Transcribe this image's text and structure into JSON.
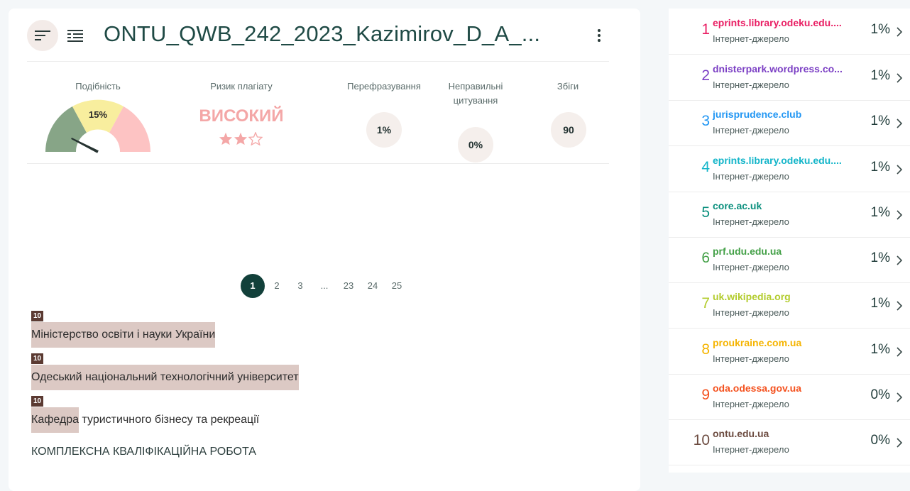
{
  "header": {
    "title": "ONTU_QWB_242_2023_Kazimirov_D_A_...",
    "icons": [
      "sort-icon",
      "list-view-icon",
      "kebab-menu-icon"
    ]
  },
  "metrics": {
    "similarity": {
      "label": "Подібність",
      "value": "15%",
      "fraction": 0.15
    },
    "risk": {
      "label": "Ризик плагіату",
      "value": "ВИСОКИЙ",
      "stars_filled": 2,
      "stars_total": 3
    },
    "paraphrase": {
      "label": "Перефразування",
      "value": "1%"
    },
    "citations": {
      "label": "Неправильні цитування",
      "value": "0%"
    },
    "matches": {
      "label": "Збіги",
      "value": "90"
    }
  },
  "pagination": {
    "pages": [
      "1",
      "2",
      "3",
      "...",
      "23",
      "24",
      "25"
    ],
    "current": "1"
  },
  "document": {
    "lines": [
      {
        "badge": "10",
        "highlight": "Міністерство освіти і науки України",
        "rest": ""
      },
      {
        "badge": "10",
        "highlight": "Одеський національний технологічний університет",
        "rest": ""
      },
      {
        "badge": "10",
        "highlight": "Кафедра",
        "rest": " туристичного бізнесу та рекреації"
      }
    ],
    "section_title": "КОМПЛЕКСНА КВАЛІФІКАЦІЙНА РОБОТА"
  },
  "sources": [
    {
      "num": "1",
      "name": "eprints.library.odeku.edu....",
      "type": "Інтернет-джерело",
      "pct": "1%",
      "color": "#e91e63"
    },
    {
      "num": "2",
      "name": "dnisterpark.wordpress.co...",
      "type": "Інтернет-джерело",
      "pct": "1%",
      "color": "#7b3fc4"
    },
    {
      "num": "3",
      "name": "jurisprudence.club",
      "type": "Інтернет-джерело",
      "pct": "1%",
      "color": "#2196f3"
    },
    {
      "num": "4",
      "name": "eprints.library.odeku.edu....",
      "type": "Інтернет-джерело",
      "pct": "1%",
      "color": "#13b5c9"
    },
    {
      "num": "5",
      "name": "core.ac.uk",
      "type": "Інтернет-джерело",
      "pct": "1%",
      "color": "#0a8f7d"
    },
    {
      "num": "6",
      "name": "prf.udu.edu.ua",
      "type": "Інтернет-джерело",
      "pct": "1%",
      "color": "#43a047"
    },
    {
      "num": "7",
      "name": "uk.wikipedia.org",
      "type": "Інтернет-джерело",
      "pct": "1%",
      "color": "#b3cc2e"
    },
    {
      "num": "8",
      "name": "proukraine.com.ua",
      "type": "Інтернет-джерело",
      "pct": "1%",
      "color": "#f5b400"
    },
    {
      "num": "9",
      "name": "oda.odessa.gov.ua",
      "type": "Інтернет-джерело",
      "pct": "0%",
      "color": "#f4511e"
    },
    {
      "num": "10",
      "name": "ontu.edu.ua",
      "type": "Інтернет-джерело",
      "pct": "0%",
      "color": "#6d4c41"
    }
  ]
}
